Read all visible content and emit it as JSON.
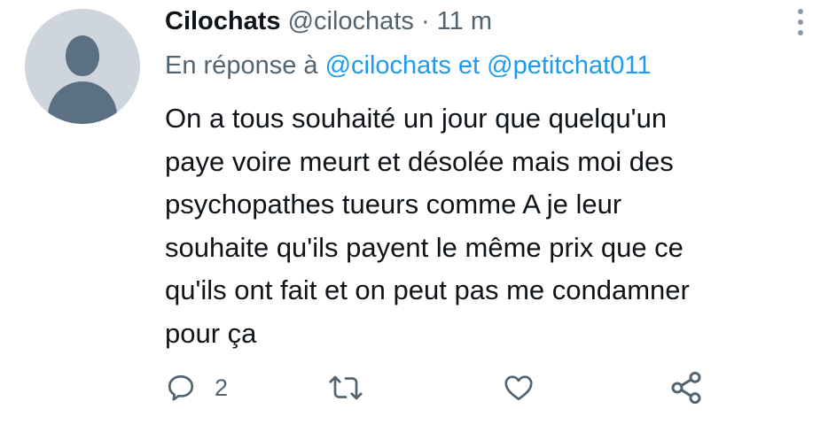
{
  "tweet": {
    "author_name": "Cilochats",
    "author_handle": "@cilochats",
    "separator": "·",
    "time": "11 m",
    "reply_prefix": "En réponse à",
    "reply_to_1": "@cilochats",
    "reply_connector": "et",
    "reply_to_2": "@petitchat011",
    "text": "On a tous souhaité un jour que quelqu'un\npaye voire meurt et désolée mais moi des\npsychopathes tueurs comme A je leur\nsouhaite qu'ils payent le même prix que ce\nqu'ils ont fait et on peut pas me condamner\npour ça"
  },
  "actions": {
    "reply_icon": "reply-icon",
    "reply_count": "2",
    "retweet_icon": "retweet-icon",
    "like_icon": "heart-icon",
    "share_icon": "share-icon"
  },
  "colors": {
    "text": "#0f1419",
    "secondary": "#536471",
    "link": "#1d9bf0",
    "avatar_bg": "#ced5dc",
    "avatar_fg": "#5b7083"
  }
}
